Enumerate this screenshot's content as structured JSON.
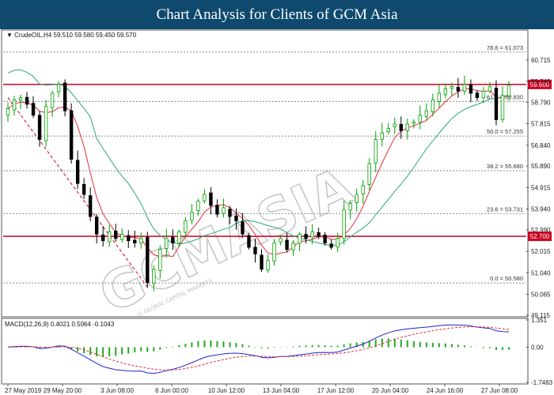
{
  "header": {
    "title": "Chart Analysis for Clients of GCM Asia"
  },
  "price_panel": {
    "info": "▼ CrudeOIL,H4  59.510 59.580 59.450 59.570",
    "watermark": "GCMASIA",
    "watermark_sub": "© GLOBAL CAPITAL MARKETS"
  },
  "macd_panel": {
    "info": "MACD(12,26,9) 0.4021 0.5064 -0.1043"
  },
  "colors": {
    "title_bg": "#0f4a6e",
    "bull": "#00a000",
    "bear": "#000000",
    "ma_fast": "#e0303a",
    "ma_slow": "#2aa877",
    "sr_line": "#cc0022",
    "macd_line": "#2222cc",
    "signal_line": "#e0303a",
    "histogram": "#22aa22"
  },
  "chart_data": [
    {
      "type": "candlestick",
      "symbol": "CrudeOIL",
      "timeframe": "H4",
      "ohlc_last": {
        "open": 59.51,
        "high": 59.58,
        "low": 59.45,
        "close": 59.57
      },
      "ylim": [
        49.115,
        62.0
      ],
      "y_ticks": [
        "60.715",
        "59.740",
        "58.790",
        "57.815",
        "56.840",
        "55.890",
        "54.915",
        "53.940",
        "52.990",
        "52.015",
        "51.040",
        "50.065",
        "49.115"
      ],
      "x_ticks": [
        "27 May 2019",
        "29 May 20:00",
        "3 Jun 08:00",
        "6 Jun 00:00",
        "10 Jun 12:00",
        "13 Jun 04:00",
        "17 Jun 12:00",
        "20 Jun 04:00",
        "24 Jun 16:00",
        "27 Jun 08:00"
      ],
      "price_path_close": [
        58.5,
        58.9,
        59.0,
        58.7,
        58.2,
        57.1,
        58.6,
        59.2,
        59.6,
        58.4,
        56.2,
        55.1,
        54.6,
        53.6,
        52.8,
        52.5,
        52.9,
        52.6,
        52.8,
        52.5,
        52.4,
        52.6,
        50.6,
        51.2,
        52.1,
        52.6,
        52.4,
        52.9,
        53.4,
        53.8,
        54.3,
        54.6,
        54.1,
        53.7,
        54.0,
        53.6,
        53.4,
        52.8,
        52.2,
        51.9,
        51.2,
        51.6,
        52.4,
        52.6,
        52.1,
        52.4,
        52.8,
        52.6,
        52.9,
        52.7,
        52.4,
        52.2,
        52.6,
        53.9,
        54.2,
        54.6,
        55.0,
        56.0,
        57.1,
        57.4,
        57.6,
        57.8,
        57.5,
        57.8,
        57.9,
        58.2,
        58.4,
        58.9,
        59.2,
        59.4,
        59.5,
        59.3,
        59.6,
        59.2,
        59.0,
        59.3,
        59.5,
        58.0,
        59.1,
        59.57
      ],
      "fib_levels": [
        {
          "label": "78.6 = 61.073",
          "value": 61.073
        },
        {
          "label": "61.8 = 58.830",
          "value": 58.83
        },
        {
          "label": "50.0 = 57.255",
          "value": 57.255
        },
        {
          "label": "38.2 = 55.680",
          "value": 55.68
        },
        {
          "label": "23.6 = 53.731",
          "value": 53.731
        },
        {
          "label": "0.0 = 50.580",
          "value": 50.58
        }
      ],
      "support_resistance": [
        {
          "label": "59.600",
          "value": 59.6
        },
        {
          "label": "52.700",
          "value": 52.7
        }
      ],
      "overlays": [
        "MA fast (red)",
        "MA slow (green)",
        "dashed red trendline"
      ]
    },
    {
      "type": "macd",
      "params": "12,26,9",
      "macd": 0.4021,
      "signal": 0.5064,
      "histogram": -0.1043,
      "ylim": [
        -1.7483,
        1.351
      ],
      "y_ticks": [
        "1.351",
        "0.00",
        "-1.7483"
      ]
    }
  ]
}
